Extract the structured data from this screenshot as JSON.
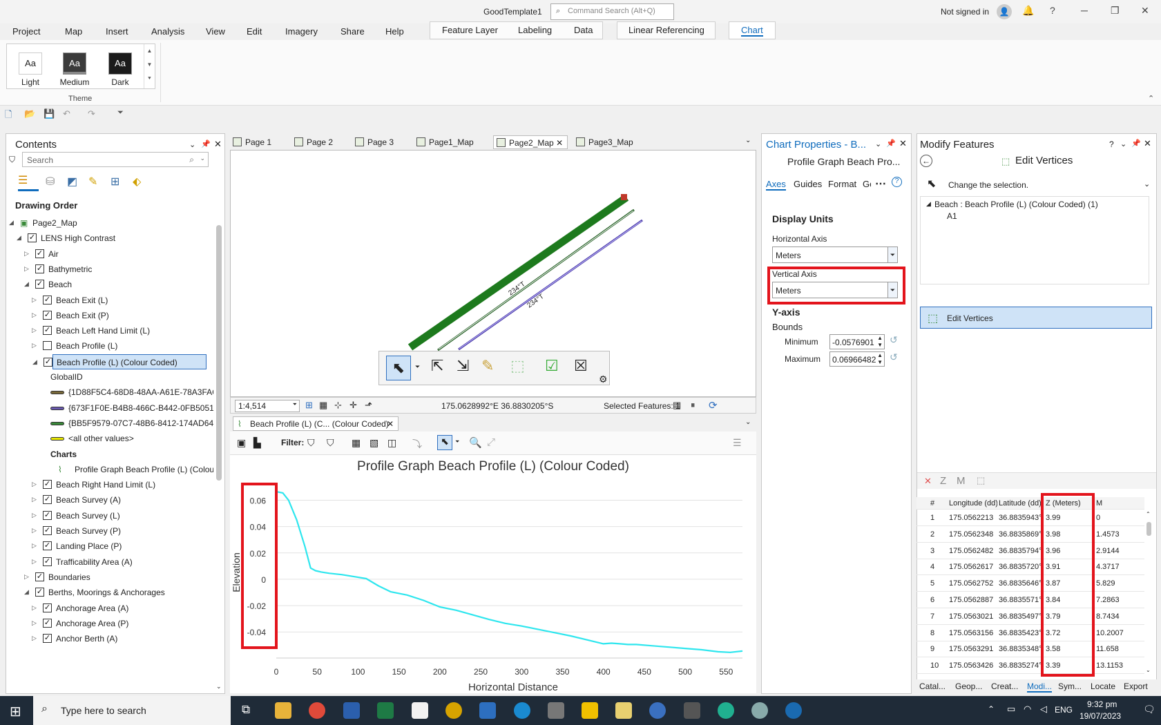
{
  "window": {
    "title": "GoodTemplate1",
    "command_search_placeholder": "Command Search (Alt+Q)",
    "sign_in": "Not signed in"
  },
  "ribbon": {
    "tabs": [
      "Project",
      "Map",
      "Insert",
      "Analysis",
      "View",
      "Edit",
      "Imagery",
      "Share",
      "Help"
    ],
    "context_tabs": [
      "Feature Layer",
      "Labeling",
      "Data"
    ],
    "linear_referencing": "Linear Referencing",
    "chart_tab": "Chart",
    "themes": [
      "Light",
      "Medium",
      "Dark"
    ],
    "theme_sample": "Aa",
    "theme_group": "Theme"
  },
  "contents": {
    "title": "Contents",
    "search_placeholder": "Search",
    "drawing_order": "Drawing Order",
    "rows": [
      {
        "label": "Page2_Map",
        "indent": 0,
        "check": "none",
        "tri": "◢",
        "icon": "map"
      },
      {
        "label": "LENS High Contrast",
        "indent": 1,
        "check": "checked",
        "tri": "◢"
      },
      {
        "label": "Air",
        "indent": 2,
        "check": "checked",
        "tri": "▷"
      },
      {
        "label": "Bathymetric",
        "indent": 2,
        "check": "checked",
        "tri": "▷"
      },
      {
        "label": "Beach",
        "indent": 2,
        "check": "checked",
        "tri": "◢"
      },
      {
        "label": "Beach Exit (L)",
        "indent": 3,
        "check": "checked",
        "tri": "▷"
      },
      {
        "label": "Beach Exit (P)",
        "indent": 3,
        "check": "checked",
        "tri": "▷"
      },
      {
        "label": "Beach Left Hand Limit (L)",
        "indent": 3,
        "check": "checked",
        "tri": "▷"
      },
      {
        "label": "Beach Profile (L)",
        "indent": 3,
        "check": "unchecked",
        "tri": "▷"
      },
      {
        "label": "Beach Profile (L) (Colour Coded)",
        "indent": 3,
        "check": "checked",
        "tri": "◢",
        "selected": true
      },
      {
        "label": "GlobalID",
        "indent": 4,
        "check": "none",
        "tri": ""
      },
      {
        "label": "{1D88F5C4-68D8-48AA-A61E-78A3FAC8...",
        "indent": 4,
        "check": "none",
        "tri": "",
        "swatch": "#7a6a3a"
      },
      {
        "label": "{673F1F0E-B4B8-466C-B442-0FB505111...",
        "indent": 4,
        "check": "none",
        "tri": "",
        "swatch": "#6a5ab0"
      },
      {
        "label": "{BB5F9579-07C7-48B6-8412-174AD64A...",
        "indent": 4,
        "check": "none",
        "tri": "",
        "swatch": "#3a8a3a"
      },
      {
        "label": "<all other values>",
        "indent": 4,
        "check": "none",
        "tri": "",
        "swatch": "#e6e600"
      },
      {
        "label": "Charts",
        "indent": 4,
        "check": "none",
        "tri": "",
        "bold": true
      },
      {
        "label": "Profile Graph Beach Profile (L) (Colour...",
        "indent": 5,
        "check": "none",
        "tri": "",
        "icon": "chart"
      },
      {
        "label": "Beach Right Hand Limit (L)",
        "indent": 3,
        "check": "checked",
        "tri": "▷"
      },
      {
        "label": "Beach Survey (A)",
        "indent": 3,
        "check": "checked",
        "tri": "▷"
      },
      {
        "label": "Beach Survey (L)",
        "indent": 3,
        "check": "checked",
        "tri": "▷"
      },
      {
        "label": "Beach Survey (P)",
        "indent": 3,
        "check": "checked",
        "tri": "▷"
      },
      {
        "label": "Landing Place (P)",
        "indent": 3,
        "check": "checked",
        "tri": "▷"
      },
      {
        "label": "Trafficability Area (A)",
        "indent": 3,
        "check": "checked",
        "tri": "▷"
      },
      {
        "label": "Boundaries",
        "indent": 2,
        "check": "checked",
        "tri": "▷"
      },
      {
        "label": "Berths, Moorings & Anchorages",
        "indent": 2,
        "check": "checked",
        "tri": "◢"
      },
      {
        "label": "Anchorage Area (A)",
        "indent": 3,
        "check": "checked",
        "tri": "▷"
      },
      {
        "label": "Anchorage Area (P)",
        "indent": 3,
        "check": "checked",
        "tri": "▷"
      },
      {
        "label": "Anchor Berth (A)",
        "indent": 3,
        "check": "checked",
        "tri": "▷"
      }
    ]
  },
  "map": {
    "tabs": [
      "Page 1",
      "Page 2",
      "Page 3",
      "Page1_Map",
      "Page2_Map",
      "Page3_Map"
    ],
    "active_tab": "Page2_Map",
    "line_label": "234°T",
    "scale": "1:4,514",
    "coords": "175.0628992°E 36.8830205°S",
    "selected_features": "Selected Features: 1"
  },
  "chart_view": {
    "tab_label": "Beach Profile (L) (C... (Colour Coded)",
    "filter_label": "Filter:"
  },
  "chart_data": {
    "type": "line",
    "title": "Profile Graph Beach Profile (L) (Colour Coded)",
    "xlabel": "Horizontal Distance",
    "ylabel": "Elevation",
    "xlim": [
      0,
      570
    ],
    "ylim": [
      -0.0576901,
      0.06966482
    ],
    "x_ticks": [
      0,
      50,
      100,
      150,
      200,
      250,
      300,
      350,
      400,
      450,
      500,
      550
    ],
    "y_ticks": [
      0.06,
      0.04,
      0.02,
      0,
      -0.02,
      -0.04
    ],
    "y_tick_labels": [
      "0.06",
      "0.04",
      "0.02",
      "0",
      "-0.02",
      "-0.04"
    ],
    "grid": true,
    "color": "#2ee6ee",
    "x": [
      0,
      8,
      15,
      25,
      35,
      42,
      48,
      55,
      65,
      80,
      95,
      110,
      125,
      140,
      160,
      180,
      200,
      220,
      240,
      260,
      280,
      300,
      320,
      340,
      360,
      380,
      390,
      400,
      410,
      420,
      430,
      440,
      460,
      480,
      500,
      520,
      540,
      555,
      570
    ],
    "y": [
      0.0665,
      0.0655,
      0.06,
      0.045,
      0.025,
      0.0085,
      0.0065,
      0.0055,
      0.0045,
      0.0035,
      0.002,
      0.0005,
      -0.005,
      -0.0095,
      -0.012,
      -0.016,
      -0.021,
      -0.0235,
      -0.027,
      -0.0305,
      -0.0335,
      -0.0355,
      -0.038,
      -0.0405,
      -0.043,
      -0.046,
      -0.0475,
      -0.049,
      -0.0485,
      -0.049,
      -0.0495,
      -0.0495,
      -0.0505,
      -0.0515,
      -0.0525,
      -0.0535,
      -0.055,
      -0.0555,
      -0.0545
    ]
  },
  "chart_props": {
    "title": "Chart Properties - B...",
    "subtitle": "Profile Graph Beach Pro...",
    "tabs": [
      "Axes",
      "Guides",
      "Format",
      "Ge"
    ],
    "display_units": "Display Units",
    "horizontal_axis_label": "Horizontal Axis",
    "horizontal_axis_value": "Meters",
    "vertical_axis_label": "Vertical Axis",
    "vertical_axis_value": "Meters",
    "y_axis_heading": "Y-axis",
    "bounds": "Bounds",
    "minimum_label": "Minimum",
    "minimum_value": "-0.0576901",
    "maximum_label": "Maximum",
    "maximum_value": "0.06966482"
  },
  "modify": {
    "title": "Modify Features",
    "tool_title": "Edit Vertices",
    "change_selection": "Change the selection.",
    "feature_group": "Beach : Beach Profile (L) (Colour Coded) (1)",
    "feature_id": "A1",
    "edit_vertices_btn": "Edit Vertices",
    "vertex_toolbar": [
      "Z",
      "M"
    ],
    "columns": [
      "#",
      "Longitude (dd)",
      "Latitude (dd)",
      "Z (Meters)",
      "M"
    ],
    "rows": [
      [
        "1",
        "175.0562213",
        "36.8835943°",
        "3.99",
        "0"
      ],
      [
        "2",
        "175.0562348",
        "36.8835869°",
        "3.98",
        "1.4573"
      ],
      [
        "3",
        "175.0562482",
        "36.8835794°",
        "3.96",
        "2.9144"
      ],
      [
        "4",
        "175.0562617",
        "36.8835720°",
        "3.91",
        "4.3717"
      ],
      [
        "5",
        "175.0562752",
        "36.8835646°",
        "3.87",
        "5.829"
      ],
      [
        "6",
        "175.0562887",
        "36.8835571°",
        "3.84",
        "7.2863"
      ],
      [
        "7",
        "175.0563021",
        "36.8835497°",
        "3.79",
        "8.7434"
      ],
      [
        "8",
        "175.0563156",
        "36.8835423°",
        "3.72",
        "10.2007"
      ],
      [
        "9",
        "175.0563291",
        "36.8835348°",
        "3.58",
        "11.658"
      ],
      [
        "10",
        "175.0563426",
        "36.8835274°",
        "3.39",
        "13.1153"
      ]
    ],
    "bottom_tabs": [
      "Catal...",
      "Geop...",
      "Creat...",
      "Modi...",
      "Sym...",
      "Locate",
      "Export"
    ]
  },
  "taskbar": {
    "search_placeholder": "Type here to search",
    "lang": "ENG",
    "time": "9:32 pm",
    "date": "19/07/2023"
  },
  "colors": {
    "accent": "#0f6cbd",
    "highlight_box": "#e3141c",
    "profile_line": "#2ee6ee"
  }
}
